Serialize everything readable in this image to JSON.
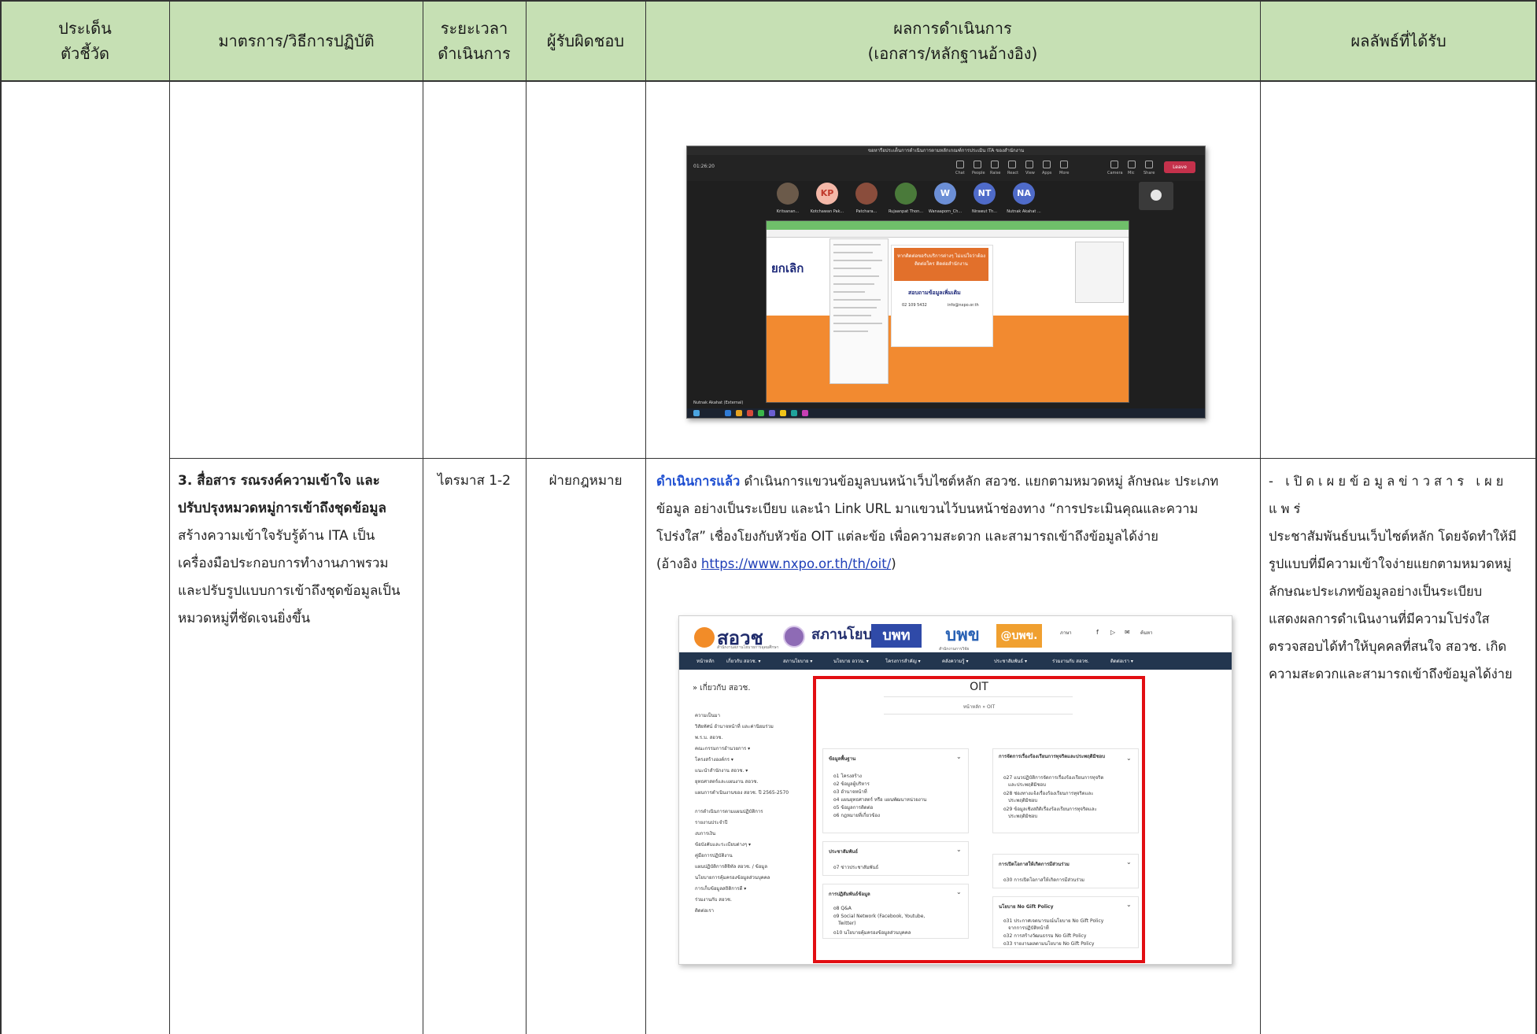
{
  "table": {
    "headers": {
      "col1": [
        "ประเด็น",
        "ตัวชี้วัด"
      ],
      "col2": "มาตรการ/วิธีการปฏิบัติ",
      "col3": [
        "ระยะเวลา",
        "ดำเนินการ"
      ],
      "col4": "ผู้รับผิดชอบ",
      "col5": [
        "ผลการดำเนินการ",
        "(เอกสาร/หลักฐานอ้างอิง)"
      ],
      "col6": "ผลลัพธ์ที่ได้รับ"
    },
    "colors": {
      "header_bg": "#c6e0b4",
      "border": "#333333",
      "highlight": "#e20e12"
    },
    "row": {
      "measure_bold": [
        "3. สื่อสาร รณรงค์ความเข้าใจ และ",
        "ปรับปรุงหมวดหมู่การเข้าถึงชุดข้อมูล"
      ],
      "measure_lines": [
        "สร้างความเข้าใจรับรู้ด้าน ITA เป็น",
        "เครื่องมือประกอบการทำงานภาพรวม",
        "และปรับรูปแบบการเข้าถึงชุดข้อมูลเป็น",
        "หมวดหมู่ที่ชัดเจนยิ่งขึ้น"
      ],
      "period": "ไตรมาส 1-2",
      "owner": "ฝ่ายกฎหมาย",
      "result_status": "ดำเนินการแล้ว",
      "result_line1": " ดำเนินการแขวนข้อมูลบนหน้าเว็บไซต์หลัก สอวช. แยกตามหมวดหมู่ ลักษณะ ประเภท",
      "result_line2": "ข้อมูล อย่างเป็นระเบียบ และนำ Link URL มาแขวนไว้บนหน้าช่องทาง “การประเมินคุณและความ",
      "result_line3": "โปร่งใส” เชื่องโยงกับหัวข้อ OIT แต่ละข้อ เพื่อความสะดวก และสามารถเข้าถึงข้อมูลได้ง่าย",
      "ref_prefix": "(อ้างอิง ",
      "ref_url": "https://www.nxpo.or.th/th/oit/",
      "ref_suffix": ")",
      "outcome_lines": [
        "- เปิดเผยข้อมูลข่าวสาร เผยแพร่",
        "ประชาสัมพันธ์บนเว็บไซต์หลัก โดยจัดทำให้มี",
        "รูปแบบที่มีความเข้าใจง่ายแยกตามหมวดหมู่",
        "ลักษณะประเภทข้อมูลอย่างเป็นระเบียบ",
        "แสดงผลการดำเนินงานที่มีความโปร่งใส",
        "ตรวจสอบได้ทำให้บุคคลที่สนใจ สอวช. เกิด",
        "ความสะดวกและสามารถเข้าถึงข้อมูลได้ง่าย"
      ]
    }
  },
  "meeting_screenshot": {
    "window_title": "ขอหารือประเด็นการดำเนินการตามหลักเกณฑ์การประเมิน ITA ของสำนักงาน",
    "timer": "01:26:20",
    "leave_label": "Leave",
    "toolbar": [
      "Chat",
      "People",
      "Raise",
      "React",
      "View",
      "Apps",
      "More",
      "Camera",
      "Mic",
      "Share"
    ],
    "participants": [
      {
        "initials": "",
        "name": "Kritsanan...",
        "color": "#6b5a4a"
      },
      {
        "initials": "KP",
        "name": "Kotchawan Pak...",
        "color": "#f4b8a8"
      },
      {
        "initials": "",
        "name": "Patchara...",
        "color": "#8a4d3c"
      },
      {
        "initials": "",
        "name": "Rujaanpat Thon...",
        "color": "#4a7a3a"
      },
      {
        "initials": "W",
        "name": "Wanaaporn_Ch...",
        "color": "#6c8fd6"
      },
      {
        "initials": "NT",
        "name": "Nirawut Th...",
        "color": "#4f6bc9"
      },
      {
        "initials": "NA",
        "name": "Nutnak Akahat ...",
        "color": "#4f6bc9"
      }
    ],
    "external_label": "Nutnak Akahat (External)",
    "site_brand": "ยกเลิก",
    "site_banner": "หากติดต่อขอรับบริการต่างๆ ไม่แน่ใจว่าต้องติดต่อใคร ติดต่อสำนักงาน",
    "site_contact": "สอบถามข้อมูลเพิ่มเติม",
    "site_phone": "02 109 5432",
    "site_email": "info@nxpo.or.th"
  },
  "website_screenshot": {
    "logo_text": "สอวช",
    "logo_sub": "สำนักงานสภานโยบายการอุดมศึกษา",
    "sapan": "สภานโยบาย",
    "uwn": "บพท",
    "bpt": "บพข",
    "bpt_sub": "สำนักงานการวิจัย",
    "upw": "@บพข.",
    "lang": "ภาษา",
    "search": "ค้นหา",
    "nav": [
      "หน้าหลัก",
      "เกี่ยวกับ สอวช. ▾",
      "สภานโยบาย ▾",
      "นโยบาย อววน. ▾",
      "โครงการสำคัญ ▾",
      "คลังความรู้ ▾",
      "ประชาสัมพันธ์ ▾",
      "ร่วมงานกับ สอวช.",
      "ติดต่อเรา ▾"
    ],
    "side_heading": "» เกี่ยวกับ สอวช.",
    "side_items": [
      "ความเป็นมา",
      "วิสัยทัศน์ อำนาจหน้าที่ และค่านิยมร่วม",
      "พ.ร.บ. สอวช.",
      "คณะกรรมการอำนวยการ ▾",
      "โครงสร้างองค์กร ▾",
      "แนะนำสำนักงาน สอวช. ▾",
      "ยุทธศาสตร์และแผนงาน สอวช.",
      "แผนการดำเนินงานของ สอวช. ปี 2565-2570",
      "การดำเนินการตามแผนปฏิบัติการ",
      "รายงานประจำปี",
      "งบการเงิน",
      "ข้อบังคับและระเบียบต่างๆ ▾",
      "คู่มือการปฏิบัติงาน",
      "แผนปฏิบัติการดิจิทัล สอวช. / ข้อมูล",
      "นโยบายการคุ้มครองข้อมูลส่วนบุคคล",
      "การเก็บข้อมูลสถิติการดี ▾",
      "ร่วมงานกับ สอวช.",
      "ติดต่อเรา"
    ],
    "oit_title": "OIT",
    "breadcrumb": "หน้าหลัก » OIT",
    "boxes": [
      {
        "title": "ข้อมูลพื้นฐาน",
        "items": [
          "o1 โครงสร้าง",
          "o2 ข้อมูลผู้บริหาร",
          "o3 อำนาจหน้าที่",
          "o4 แผนยุทธศาสตร์ หรือ แผนพัฒนาหน่วยงาน",
          "o5 ข้อมูลการติดต่อ",
          "o6 กฎหมายที่เกี่ยวข้อง"
        ]
      },
      {
        "title": "ประชาสัมพันธ์",
        "items": [
          "o7 ข่าวประชาสัมพันธ์"
        ]
      },
      {
        "title": "การปฏิสัมพันธ์ข้อมูล",
        "items": [
          "o8 Q&A",
          "o9 Social Network (Facebook, Youtube,",
          "Twitter)",
          "o10 นโยบายคุ้มครองข้อมูลส่วนบุคคล"
        ]
      },
      {
        "title": "การจัดการเรื่องร้องเรียนการทุจริตและประพฤติมิชอบ",
        "items": [
          "o27 แนวปฏิบัติการจัดการเรื่องร้องเรียนการทุจริต",
          "และประพฤติมิชอบ",
          "o28 ช่องทางแจ้งเรื่องร้องเรียนการทุจริตและ",
          "ประพฤติมิชอบ",
          "o29 ข้อมูลเชิงสถิติเรื่องร้องเรียนการทุจริตและ",
          "ประพฤติมิชอบ"
        ]
      },
      {
        "title": "การเปิดโอกาสให้เกิดการมีส่วนร่วม",
        "items": [
          "o30 การเปิดโอกาสให้เกิดการมีส่วนร่วม"
        ]
      },
      {
        "title": "นโยบาย No Gift Policy",
        "items": [
          "o31 ประกาศเจตนารมณ์นโยบาย No Gift Policy",
          "จากการปฏิบัติหน้าที่",
          "o32 การสร้างวัฒนธรรม No Gift Policy",
          "o33 รายงานผลตามนโยบาย No Gift Policy"
        ]
      }
    ]
  }
}
